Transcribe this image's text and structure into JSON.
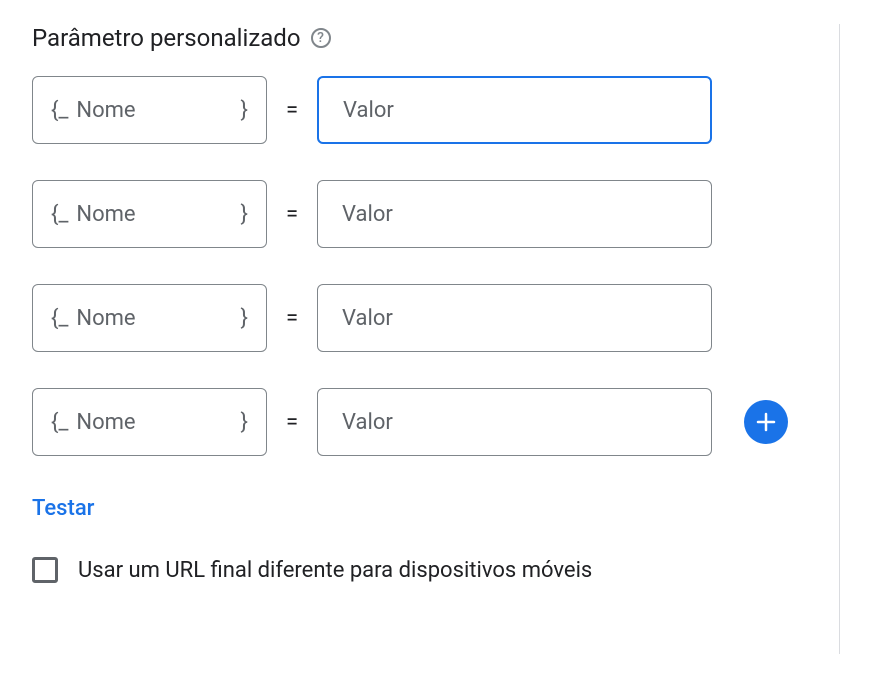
{
  "section": {
    "title": "Parâmetro personalizado",
    "help_symbol": "?"
  },
  "params": {
    "name_prefix": "{_",
    "name_suffix": "}",
    "name_placeholder": "Nome",
    "equals": "=",
    "value_placeholder": "Valor",
    "rows": [
      {
        "name": "",
        "value": "",
        "focused": true
      },
      {
        "name": "",
        "value": "",
        "focused": false
      },
      {
        "name": "",
        "value": "",
        "focused": false
      },
      {
        "name": "",
        "value": "",
        "focused": false
      }
    ]
  },
  "actions": {
    "test_label": "Testar"
  },
  "checkbox": {
    "label": "Usar um URL final diferente para dispositivos móveis",
    "checked": false
  }
}
